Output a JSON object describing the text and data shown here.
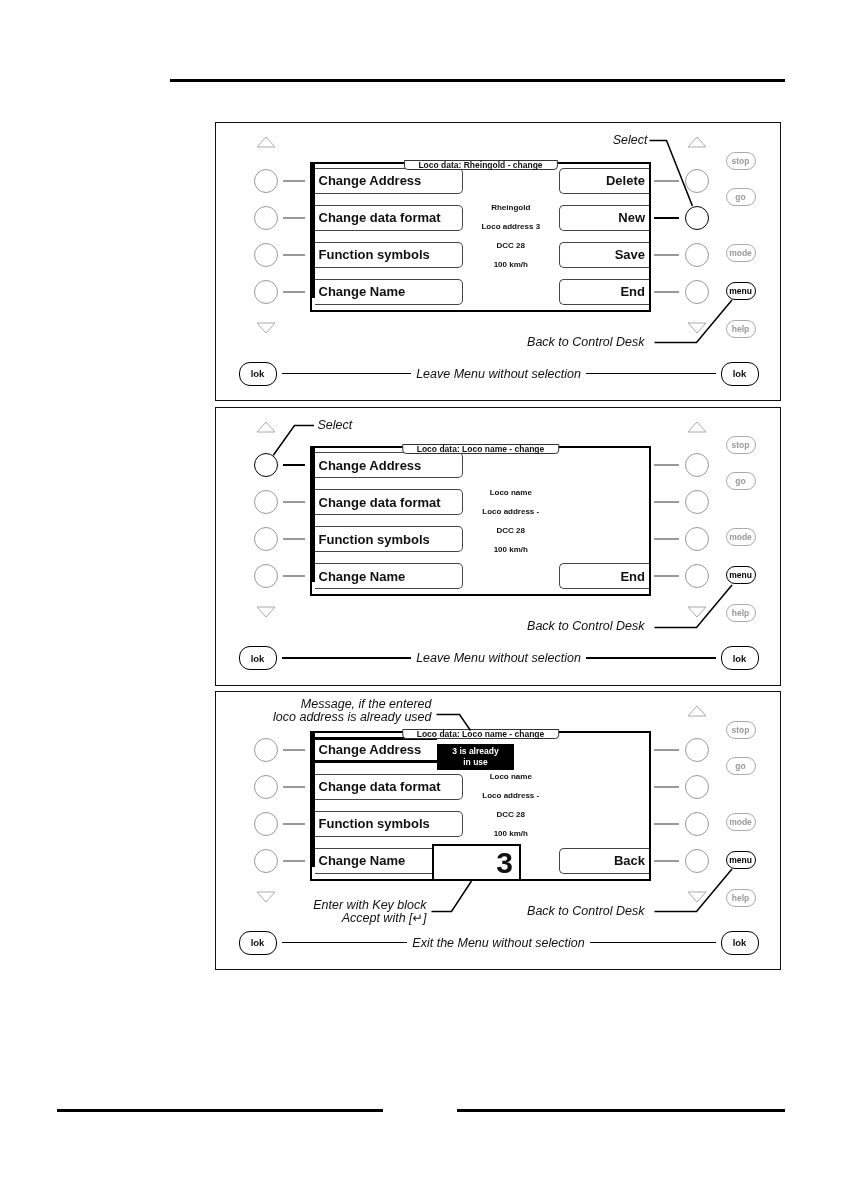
{
  "panels": [
    {
      "arrows": {
        "left_up": true,
        "left_down": true,
        "right_up": true,
        "right_down": true
      },
      "callouts": [
        {
          "kind": "select",
          "lines": [
            "Select"
          ]
        },
        {
          "kind": "menu",
          "lines": [
            "Back to Control Desk"
          ]
        }
      ],
      "left_keys": [
        {
          "selected": false
        },
        {
          "selected": false
        },
        {
          "selected": false
        },
        {
          "selected": false
        }
      ],
      "screen": {
        "title": "Loco data: Rheingold - change",
        "left_buttons": [
          {
            "label": "Change Address",
            "selected": false
          },
          {
            "label": "Change data format",
            "selected": false
          },
          {
            "label": "Function symbols",
            "selected": false
          },
          {
            "label": "Change Name",
            "selected": false
          }
        ],
        "info": [
          "Rheingold",
          "Loco address 3",
          "DCC 28",
          "100 km/h"
        ],
        "right_buttons": [
          "Delete",
          "New",
          "Save",
          "End"
        ]
      },
      "right_keys": [
        {
          "selected": false
        },
        {
          "selected": true
        },
        {
          "selected": false
        },
        {
          "selected": false
        }
      ],
      "side_keys": [
        {
          "label": "stop",
          "active": false
        },
        {
          "label": "go",
          "active": false
        },
        {
          "label": "mode",
          "active": false
        },
        {
          "label": "menu",
          "active": true
        },
        {
          "label": "help",
          "active": false
        }
      ],
      "bottom": {
        "left_key": "lok",
        "label": "Leave Menu without selection",
        "right_key": "lok"
      }
    },
    {
      "arrows": {
        "left_up": true,
        "left_down": true,
        "right_up": true,
        "right_down": true
      },
      "callouts": [
        {
          "kind": "select",
          "lines": [
            "Select"
          ]
        },
        {
          "kind": "menu",
          "lines": [
            "Back to Control Desk"
          ]
        }
      ],
      "left_keys": [
        {
          "selected": true
        },
        {
          "selected": false
        },
        {
          "selected": false
        },
        {
          "selected": false
        }
      ],
      "screen": {
        "title": "Loco data: Loco name - change",
        "left_buttons": [
          {
            "label": "Change Address",
            "selected": false
          },
          {
            "label": "Change data format",
            "selected": false
          },
          {
            "label": "Function symbols",
            "selected": false
          },
          {
            "label": "Change Name",
            "selected": false
          }
        ],
        "info": [
          "Loco name",
          "Loco address -",
          "DCC 28",
          "100 km/h"
        ],
        "right_buttons": [
          "End"
        ]
      },
      "right_keys": [
        {
          "selected": false
        },
        {
          "selected": false
        },
        {
          "selected": false
        },
        {
          "selected": false
        }
      ],
      "side_keys": [
        {
          "label": "stop",
          "active": false
        },
        {
          "label": "go",
          "active": false
        },
        {
          "label": "mode",
          "active": false
        },
        {
          "label": "menu",
          "active": true
        },
        {
          "label": "help",
          "active": false
        }
      ],
      "bottom": {
        "left_key": "lok",
        "label": "Leave Menu without selection",
        "right_key": "lok"
      }
    },
    {
      "arrows": {
        "left_up": false,
        "left_down": true,
        "right_up": true,
        "right_down": true
      },
      "callouts": [
        {
          "kind": "message",
          "lines": [
            "Message, if the entered",
            "loco address is already used"
          ]
        },
        {
          "kind": "entry",
          "lines": [
            "Enter with Key block",
            "Accept with [↵]"
          ]
        },
        {
          "kind": "menu",
          "lines": [
            "Back to Control Desk"
          ]
        }
      ],
      "left_keys": [
        {
          "selected": false
        },
        {
          "selected": false
        },
        {
          "selected": false
        },
        {
          "selected": false
        }
      ],
      "screen": {
        "title": "Loco data: Loco name - change",
        "left_buttons": [
          {
            "label": "Change Address",
            "selected": true
          },
          {
            "label": "Change data format",
            "selected": false
          },
          {
            "label": "Function symbols",
            "selected": false
          },
          {
            "label": "Change Name",
            "selected": false
          }
        ],
        "popup": {
          "lines": [
            "3 is already",
            "in use"
          ]
        },
        "info": [
          "Loco name",
          "Loco address -",
          "DCC 28",
          "100 km/h"
        ],
        "entry": {
          "value": "3"
        },
        "right_buttons": [
          "Back"
        ]
      },
      "right_keys": [
        {
          "selected": false
        },
        {
          "selected": false
        },
        {
          "selected": false
        },
        {
          "selected": false
        }
      ],
      "side_keys": [
        {
          "label": "stop",
          "active": false
        },
        {
          "label": "go",
          "active": false
        },
        {
          "label": "mode",
          "active": false
        },
        {
          "label": "menu",
          "active": true
        },
        {
          "label": "help",
          "active": false
        }
      ],
      "bottom": {
        "left_key": "lok",
        "label": "Exit the Menu without selection",
        "right_key": "lok"
      }
    }
  ]
}
